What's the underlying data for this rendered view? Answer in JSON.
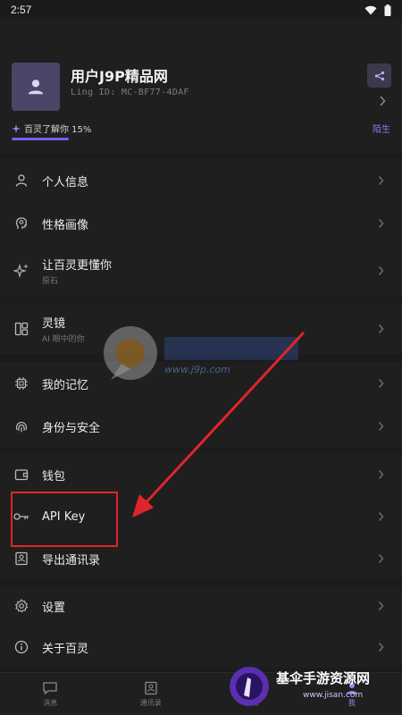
{
  "status": {
    "time": "2:57"
  },
  "profile": {
    "username": "用户J9P精品网",
    "ling_id": "Ling ID: MC-BF77-4DAF",
    "understanding": "百灵了解你 15%",
    "understanding_level": 0.15,
    "relation": "陌生"
  },
  "menu": {
    "group1": [
      {
        "label": "个人信息",
        "sub": ""
      },
      {
        "label": "性格画像",
        "sub": ""
      },
      {
        "label": "让百灵更懂你",
        "sub": "原石"
      }
    ],
    "group2": [
      {
        "label": "灵镜",
        "sub": "AI 眼中的你"
      }
    ],
    "group3": [
      {
        "label": "我的记忆",
        "sub": ""
      },
      {
        "label": "身份与安全",
        "sub": ""
      }
    ],
    "group4": [
      {
        "label": "钱包",
        "sub": ""
      },
      {
        "label": "API Key",
        "sub": ""
      },
      {
        "label": "导出通讯录",
        "sub": ""
      }
    ],
    "group5": [
      {
        "label": "设置",
        "sub": ""
      },
      {
        "label": "关于百灵",
        "sub": ""
      }
    ]
  },
  "nav": [
    {
      "label": "消息"
    },
    {
      "label": "通讯录"
    },
    {
      "label": "发现"
    },
    {
      "label": "我"
    }
  ],
  "watermark": {
    "center_url": "www.j9p.com",
    "bottom_text": "基伞手游资源网",
    "bottom_url": "www.jisan.com"
  },
  "colors": {
    "accent": "#7c5cf4",
    "annotation": "#e0252a",
    "background": "#1b1b1b",
    "surface": "#1f1f1f"
  }
}
